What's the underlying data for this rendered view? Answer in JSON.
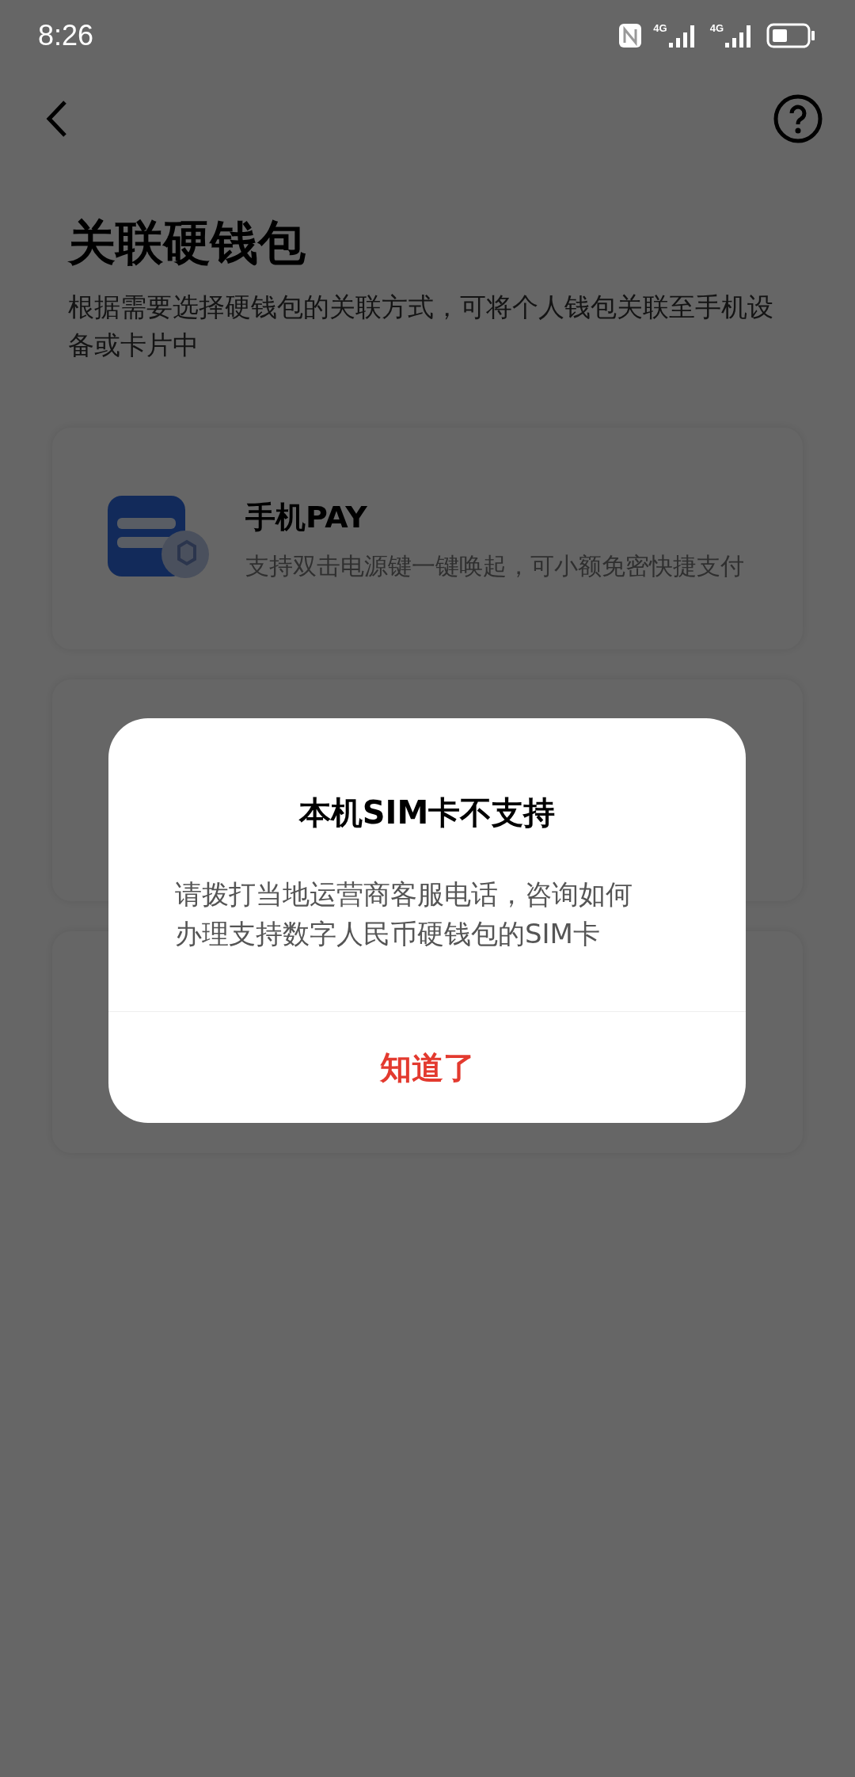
{
  "status_bar": {
    "time": "8:26",
    "network_labels": [
      "4G",
      "4G"
    ]
  },
  "header": {
    "title": "关联硬钱包",
    "subtitle": "根据需要选择硬钱包的关联方式，可将个人钱包关联至手机设备或卡片中"
  },
  "options": [
    {
      "kind": "phone_pay",
      "title": "手机PAY",
      "description": "支持双击电源键一键唤起，可小额免密快捷支付"
    },
    {
      "kind": "covered"
    },
    {
      "kind": "covered"
    }
  ],
  "dialog": {
    "title": "本机SIM卡不支持",
    "message": "请拨打当地运营商客服电话，咨询如何办理支持数字人民币硬钱包的SIM卡",
    "button": "知道了"
  }
}
